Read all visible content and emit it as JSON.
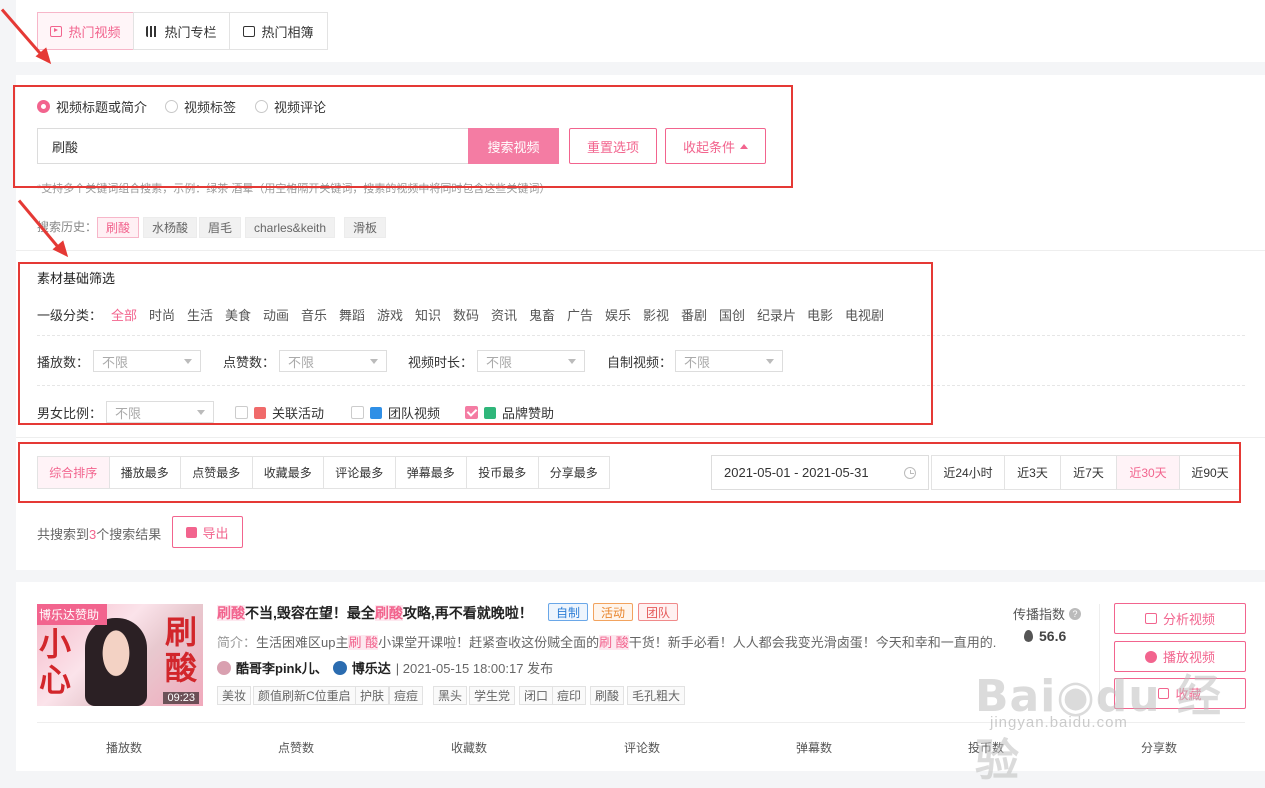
{
  "tabs": [
    {
      "label": "热门视频",
      "icon": "play-icon",
      "active": true
    },
    {
      "label": "热门专栏",
      "icon": "books-icon",
      "active": false
    },
    {
      "label": "热门相簿",
      "icon": "image-icon",
      "active": false
    }
  ],
  "search": {
    "modes": [
      "视频标题或简介",
      "视频标签",
      "视频评论"
    ],
    "query": "刷酸",
    "search_button": "搜索视频",
    "reset_button": "重置选项",
    "collapse_button": "收起条件",
    "hint": "*支持多个关键词组合搜索，示例：绿茶 酒晕（用空格隔开关键词，搜索的视频中将同时包含这些关键词）",
    "history_label": "搜索历史：",
    "history": [
      "刷酸",
      "水杨酸",
      "眉毛",
      "charles&keith",
      "滑板"
    ]
  },
  "filters": {
    "title": "素材基础筛选",
    "category_label": "一级分类：",
    "categories": [
      "全部",
      "时尚",
      "生活",
      "美食",
      "动画",
      "音乐",
      "舞蹈",
      "游戏",
      "知识",
      "数码",
      "资讯",
      "鬼畜",
      "广告",
      "娱乐",
      "影视",
      "番剧",
      "国创",
      "纪录片",
      "电影",
      "电视剧"
    ],
    "play_label": "播放数：",
    "like_label": "点赞数：",
    "duration_label": "视频时长：",
    "selfmade_label": "自制视频：",
    "gender_label": "男女比例：",
    "unlimited": "不限",
    "check_activity": "关联活动",
    "check_team": "团队视频",
    "check_brand": "品牌赞助"
  },
  "sort": {
    "options": [
      "综合排序",
      "播放最多",
      "点赞最多",
      "收藏最多",
      "评论最多",
      "弹幕最多",
      "投币最多",
      "分享最多"
    ],
    "date_range": "2021-05-01 - 2021-05-31",
    "ranges": [
      "近24小时",
      "近3天",
      "近7天",
      "近30天",
      "近90天"
    ]
  },
  "results": {
    "prefix": "共搜索到",
    "count": "3",
    "suffix": "个搜索结果",
    "export_button": "导出"
  },
  "video": {
    "sponsor_badge": "博乐达赞助",
    "duration": "09:23",
    "thumb_text_1": "刷",
    "thumb_text_2": "酸",
    "thumb_text_3": "小",
    "thumb_text_4": "心",
    "title_hl_1": "刷酸",
    "title_part_1": "不当,毁容在望！最全",
    "title_hl_2": "刷酸",
    "title_part_2": "攻略,再不看就晚啦！",
    "tags": [
      "自制",
      "活动",
      "团队"
    ],
    "desc_label": "简介：",
    "desc_part_1": "生活困难区up主",
    "desc_hl_1": "刷 酸",
    "desc_part_2": "小课堂开课啦！赶紧查收这份贼全面的",
    "desc_hl_2": "刷 酸",
    "desc_part_3": "干货！新手必看！人人都会我变光滑卤蛋！今天和幸和一直用的...",
    "author": "酷哥李pink儿、",
    "brand": "博乐达",
    "publish": "| 2021-05-15 18:00:17 发布",
    "keywords": [
      "美妆",
      "颜值刷新C位重启",
      "护肤",
      "痘痘",
      "黑头",
      "学生党",
      "闭口",
      "痘印",
      "刷酸",
      "毛孔粗大"
    ],
    "spread_label": "传播指数",
    "spread_value": "56.6",
    "analyze_button": "分析视频",
    "play_button": "播放视频",
    "collect_button": "收藏",
    "stat_headers": [
      "播放数",
      "点赞数",
      "收藏数",
      "评论数",
      "弹幕数",
      "投币数",
      "分享数"
    ]
  },
  "colors": {
    "accent": "#f2648e",
    "annotation": "#e53935"
  }
}
